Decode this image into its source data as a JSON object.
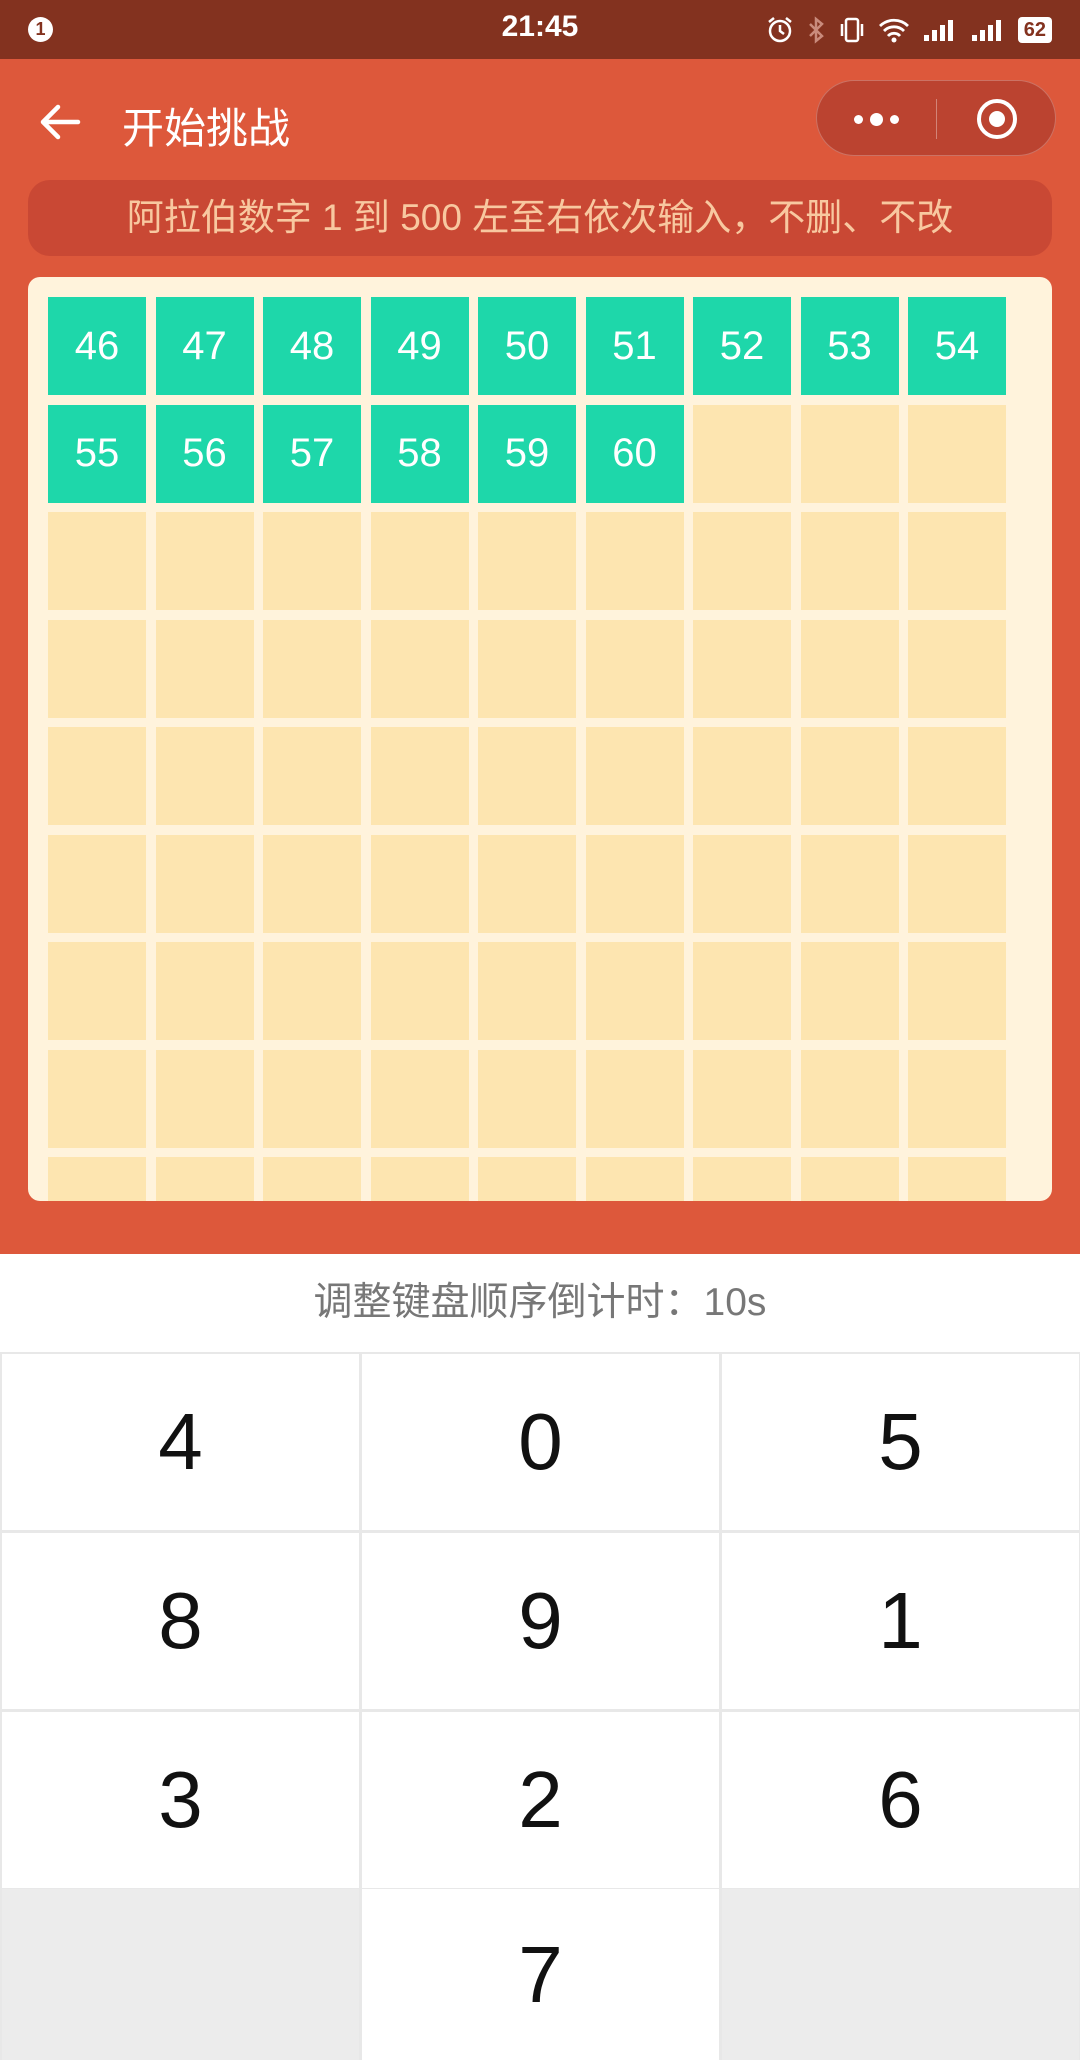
{
  "status_bar": {
    "notification_count": "1",
    "time": "21:45",
    "battery": "62",
    "icons": [
      "alarm-icon",
      "bluetooth-icon",
      "vibrate-icon",
      "wifi-icon",
      "signal-icon",
      "signal-icon",
      "battery-icon"
    ]
  },
  "header": {
    "title": "开始挑战",
    "back_icon": "arrow-left-icon",
    "more_icon": "more-dots-icon",
    "close_icon": "target-circle-icon"
  },
  "instruction": "阿拉伯数字 1 到 500 左至右依次输入，不删、不改",
  "board": {
    "columns": 9,
    "filled_numbers": [
      "46",
      "47",
      "48",
      "49",
      "50",
      "51",
      "52",
      "53",
      "54",
      "55",
      "56",
      "57",
      "58",
      "59",
      "60"
    ],
    "total_cells_visible": 81
  },
  "countdown": "调整键盘顺序倒计时：10s",
  "keypad": {
    "keys": [
      "4",
      "0",
      "5",
      "8",
      "9",
      "1",
      "3",
      "2",
      "6",
      "",
      "7",
      ""
    ]
  },
  "colors": {
    "status_bar": "#83321f",
    "header_bg": "#dd583b",
    "instruction_bg": "#c94834",
    "instruction_text": "#f8c8a0",
    "board_bg": "#fff3dc",
    "empty_cell": "#fde5b0",
    "filled_cell": "#1ed7aa"
  }
}
